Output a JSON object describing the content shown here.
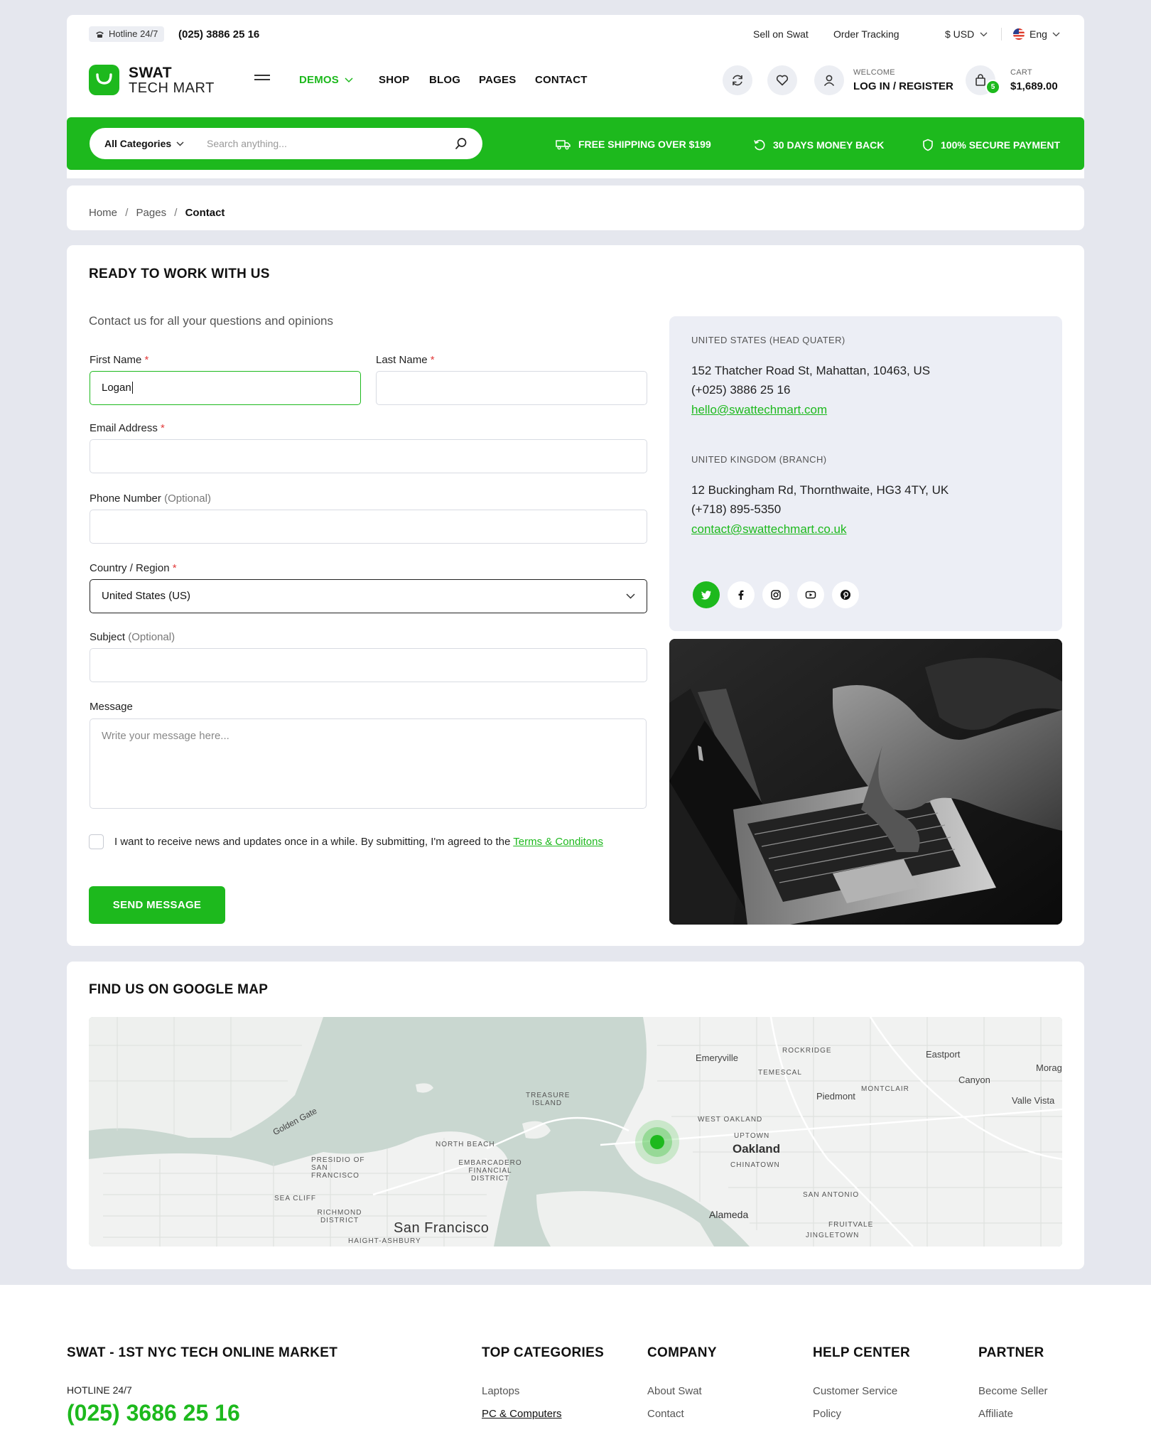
{
  "header": {
    "hotline_label": "Hotline 24/7",
    "hotline_phone": "(025) 3886 25 16",
    "top_links": [
      "Sell on Swat",
      "Order Tracking"
    ],
    "currency": "$ USD",
    "language": "Eng",
    "logo_line1": "SWAT",
    "logo_line2": "TECH MART",
    "nav": [
      "DEMOS",
      "SHOP",
      "BLOG",
      "PAGES",
      "CONTACT"
    ],
    "welcome_label": "WELCOME",
    "login_label": "LOG IN / REGISTER",
    "cart_label": "CART",
    "cart_total": "$1,689.00",
    "cart_count": "5"
  },
  "searchbar": {
    "category": "All Categories",
    "placeholder": "Search anything...",
    "features": [
      "FREE SHIPPING OVER $199",
      "30 DAYS MONEY BACK",
      "100% SECURE PAYMENT"
    ]
  },
  "breadcrumb": {
    "items": [
      "Home",
      "Pages",
      "Contact"
    ]
  },
  "contact": {
    "title": "READY TO WORK WITH US",
    "subtitle": "Contact us for all your questions and opinions",
    "first_name_label": "First Name",
    "first_name_value": "Logan",
    "last_name_label": "Last Name",
    "email_label": "Email Address",
    "phone_label": "Phone Number",
    "optional": "(Optional)",
    "country_label": "Country / Region",
    "country_value": "United States (US)",
    "subject_label": "Subject",
    "message_label": "Message",
    "message_placeholder": "Write your message here...",
    "consent_text": "I want to receive news and updates once in a while. By submitting, I'm agreed to the",
    "terms_link": "Terms & Conditons",
    "send_label": "SEND MESSAGE",
    "required_mark": "*"
  },
  "offices": [
    {
      "caption": "UNITED STATES (HEAD QUATER)",
      "address": "152 Thatcher Road St, Mahattan, 10463, US",
      "phone": "(+025) 3886 25 16",
      "email": "hello@swattechmart.com"
    },
    {
      "caption": "UNITED KINGDOM (BRANCH)",
      "address": "12 Buckingham Rd, Thornthwaite, HG3 4TY, UK",
      "phone": "(+718) 895-5350",
      "email": "contact@swattechmart.co.uk"
    }
  ],
  "social": [
    "twitter-icon",
    "facebook-icon",
    "instagram-icon",
    "youtube-icon",
    "pinterest-icon"
  ],
  "map": {
    "title": "FIND US ON GOOGLE MAP",
    "labels": [
      "Emeryville",
      "Eastport",
      "Canyon",
      "Morag",
      "Valle Vista",
      "Piedmont",
      "ROCKRIDGE",
      "TEMESCAL",
      "MONTCLAIR",
      "Golden Gate",
      "TREASURE ISLAND",
      "WEST OAKLAND",
      "UPTOWN",
      "Oakland",
      "CHINATOWN",
      "NORTH BEACH",
      "PRESIDIO OF SAN FRANCISCO",
      "EMBARCADERO FINANCIAL DISTRICT",
      "SEA CLIFF",
      "RICHMOND DISTRICT",
      "San Francisco",
      "HAIGHT-ASHBURY",
      "Alameda",
      "SAN ANTONIO",
      "FRUITVALE",
      "JINGLETOWN"
    ]
  },
  "footer": {
    "brand_title": "SWAT - 1ST NYC TECH ONLINE MARKET",
    "hotline_label": "HOTLINE 24/7",
    "hotline_phone": "(025) 3686 25 16",
    "columns": [
      {
        "title": "TOP CATEGORIES",
        "links": [
          "Laptops",
          "PC & Computers"
        ]
      },
      {
        "title": "COMPANY",
        "links": [
          "About Swat",
          "Contact"
        ]
      },
      {
        "title": "HELP CENTER",
        "links": [
          "Customer Service",
          "Policy"
        ]
      },
      {
        "title": "PARTNER",
        "links": [
          "Become Seller",
          "Affiliate"
        ]
      }
    ]
  },
  "colors": {
    "accent": "#1db91d",
    "page_bg": "#e5e7ee",
    "panel_bg": "#eceef5"
  }
}
